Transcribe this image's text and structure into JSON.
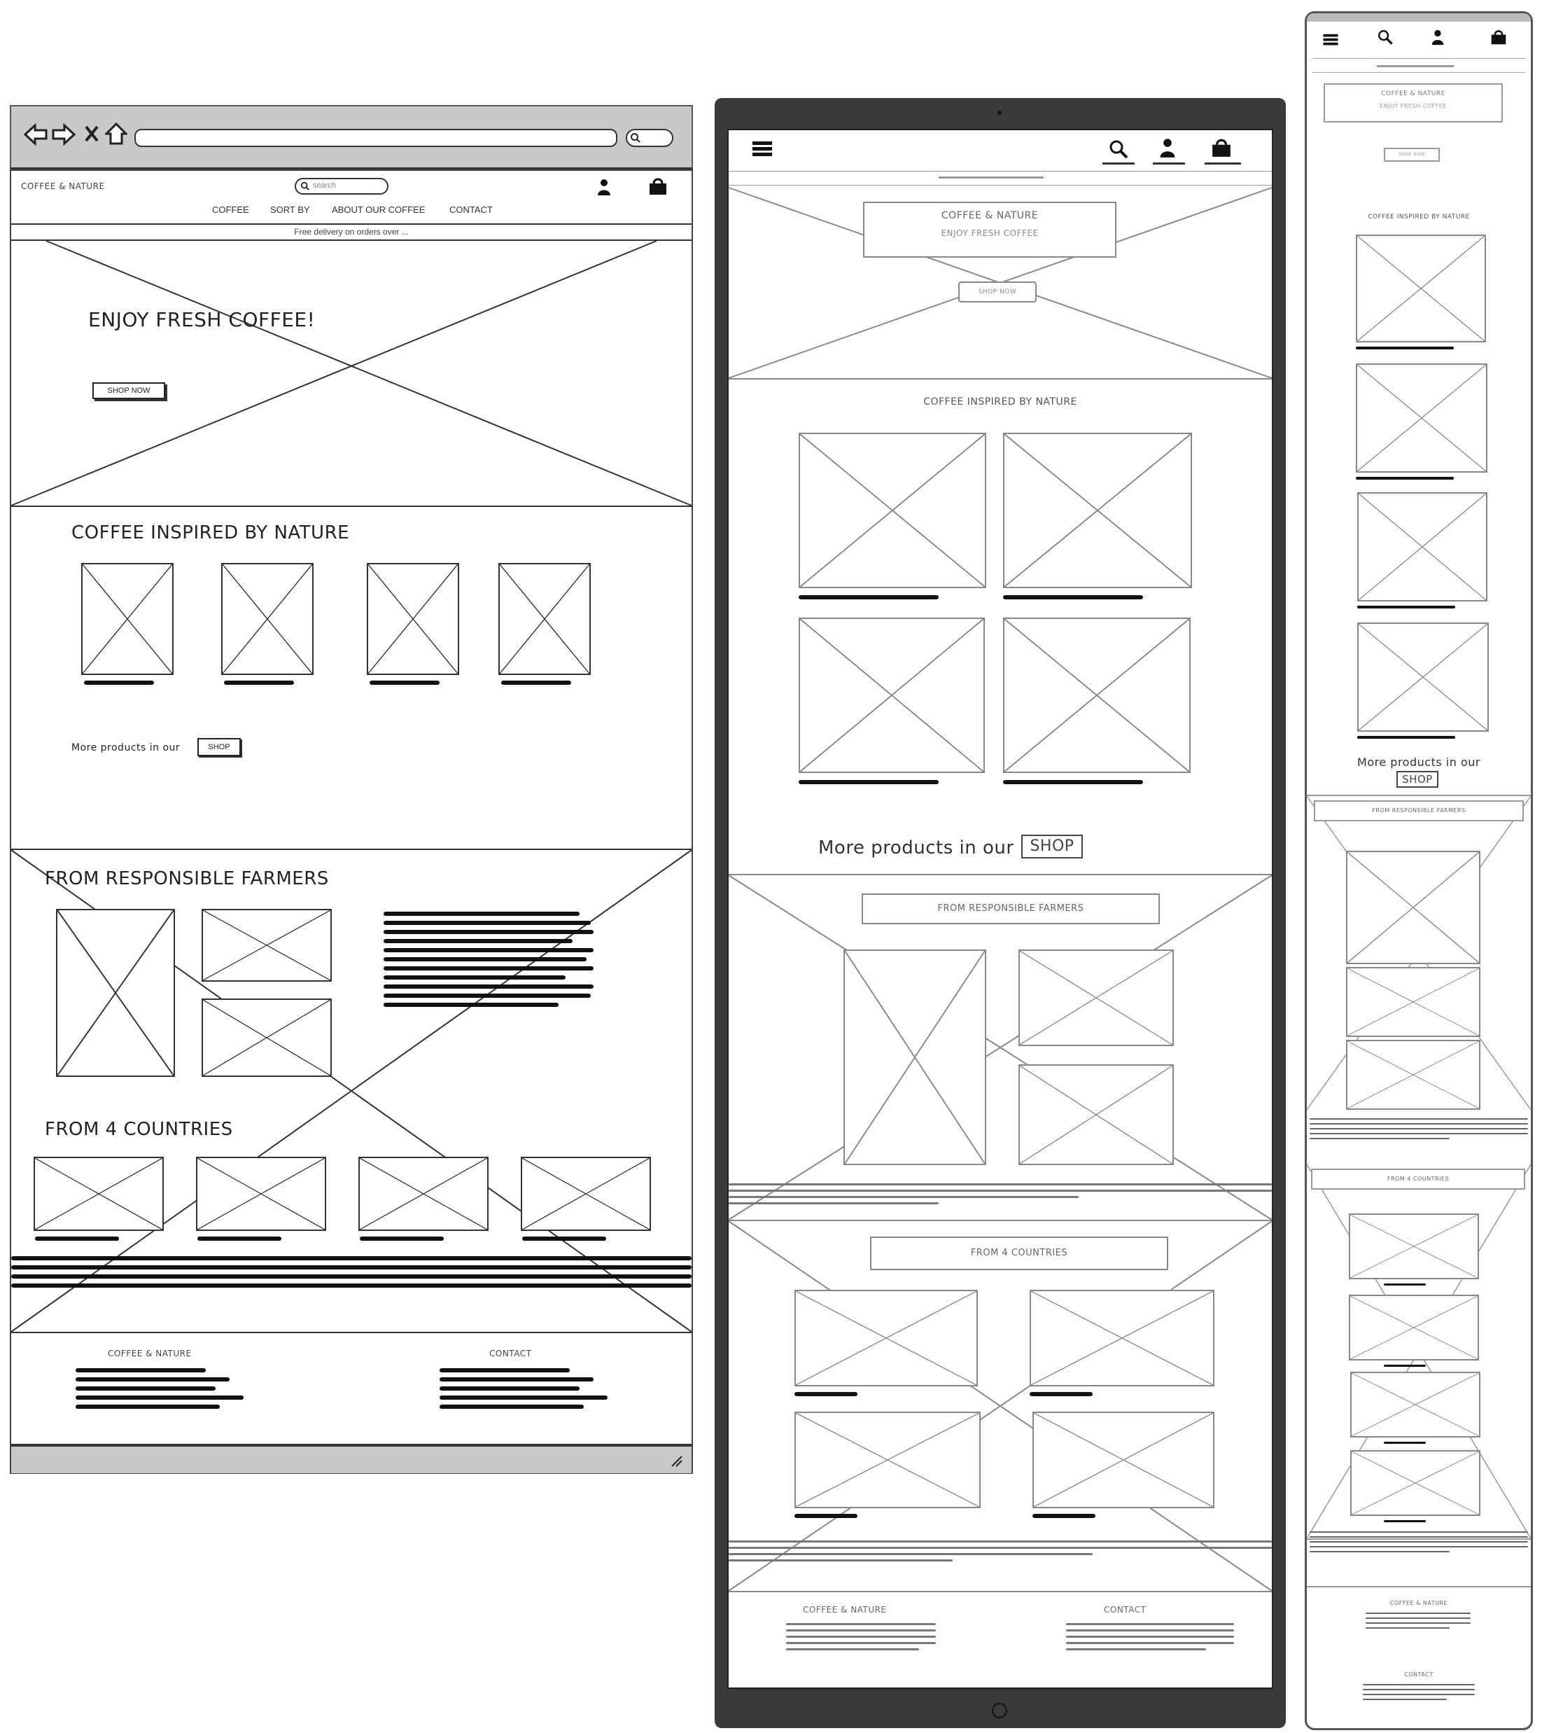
{
  "desktop": {
    "brand": "COFFEE & NATURE",
    "search_placeholder": "search",
    "nav": [
      "COFFEE",
      "SORT BY",
      "ABOUT OUR COFFEE",
      "CONTACT"
    ],
    "banner": "Free delivery on orders over ...",
    "hero_title": "ENJOY FRESH COFFEE!",
    "hero_button": "SHOP NOW",
    "section1_title": "COFFEE INSPIRED BY NATURE",
    "more_products": "More products in our",
    "shop_button": "SHOP",
    "section2_title": "FROM RESPONSIBLE FARMERS",
    "section3_title": "FROM 4 COUNTRIES",
    "footer_brand": "COFFEE & NATURE",
    "footer_contact": "CONTACT"
  },
  "tablet": {
    "hero_title": "COFFEE & NATURE",
    "hero_subtitle": "ENJOY FRESH COFFEE",
    "hero_button": "SHOP NOW",
    "section1_title": "COFFEE INSPIRED BY NATURE",
    "more_products": "More products in our",
    "shop_button": "SHOP",
    "section2_title": "FROM RESPONSIBLE FARMERS",
    "section3_title": "FROM 4 COUNTRIES",
    "footer_brand": "COFFEE & NATURE",
    "footer_contact": "CONTACT"
  },
  "mobile": {
    "hero_title": "COFFEE & NATURE",
    "hero_subtitle": "ENJOY FRESH COFFEE",
    "hero_button": "SHOP NOW",
    "section1_title": "COFFEE INSPIRED BY NATURE",
    "more_products": "More products in our",
    "shop_button": "SHOP",
    "section2_title": "FROM RESPONSIBLE FARMERS",
    "section3_title": "FROM 4 COUNTRIES",
    "footer_brand": "COFFEE & NATURE",
    "footer_contact": "CONTACT"
  },
  "icons": [
    "back-arrow-icon",
    "forward-arrow-icon",
    "close-icon",
    "home-icon",
    "search-icon",
    "user-icon",
    "cart-icon",
    "hamburger-menu-icon",
    "resize-grip-icon",
    "home-button-icon"
  ]
}
